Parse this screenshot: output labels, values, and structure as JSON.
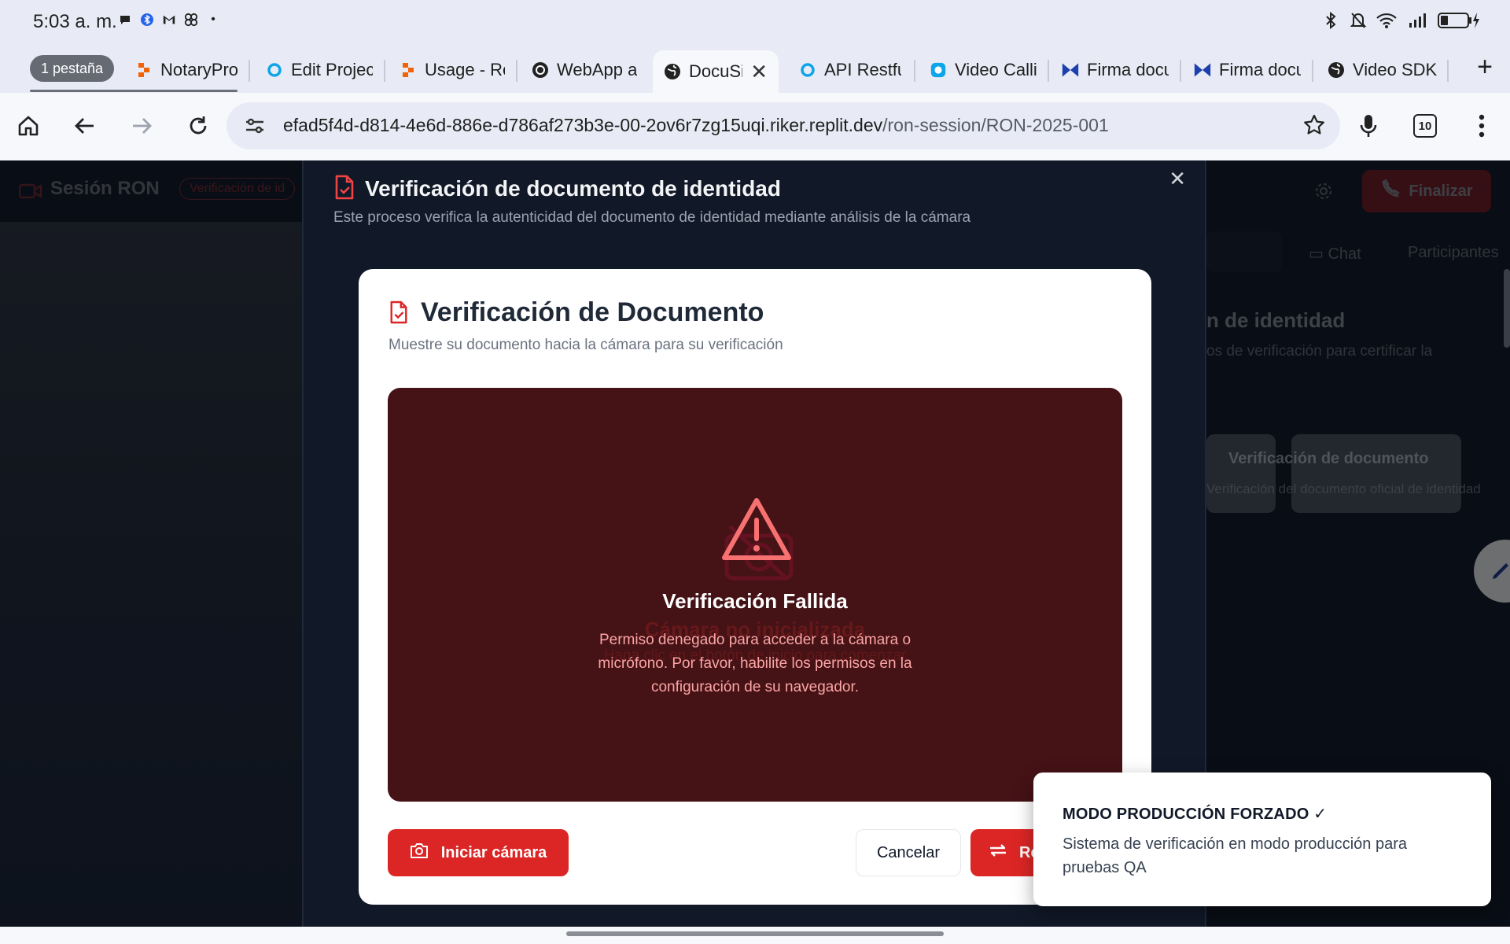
{
  "status_bar": {
    "time": "5:03 a. m.",
    "notification_icons": [
      "chat-bubble-icon",
      "bluetooth-app-icon",
      "gmail-icon",
      "pinwheel-icon",
      "dot-icon"
    ],
    "right_icons": [
      "bluetooth-icon",
      "mute-icon",
      "wifi-icon",
      "4g-signal-icon",
      "battery-charging-icon"
    ]
  },
  "browser": {
    "tab_count_label": "1 pestaña",
    "tabs": [
      {
        "label": "NotaryPro",
        "icon": "replit-icon"
      },
      {
        "label": "Edit Projec",
        "icon": "circle-app-icon"
      },
      {
        "label": "Usage - Re",
        "icon": "replit-icon"
      },
      {
        "label": "WebApp a",
        "icon": "openai-icon"
      },
      {
        "label": "DocuSiç",
        "icon": "globe-icon",
        "active": true
      },
      {
        "label": "API Restful",
        "icon": "circle-app-icon"
      },
      {
        "label": "Video Calli",
        "icon": "circle-app-icon"
      },
      {
        "label": "Firma docu",
        "icon": "bowtie-icon"
      },
      {
        "label": "Firma docu",
        "icon": "bowtie-icon"
      },
      {
        "label": "Video SDK",
        "icon": "globe-icon"
      }
    ],
    "url_host": "efad5f4d-d814-4e6d-886e-d786af273b3e-00-2ov6r7zg15uqi.riker.replit.dev",
    "url_path": "/ron-session/RON-2025-001",
    "tab_switcher_count": "10"
  },
  "page": {
    "header_title": "Sesión RON",
    "header_badge": "Verificación de id",
    "end_button": "Finalizar",
    "right_tabs": [
      "Chat",
      "Participantes"
    ],
    "right_heading": "n de identidad",
    "right_sub": "os de verificación para certificar la",
    "right_card_title": "Verificación de documento",
    "right_card_desc": "Verificación del documento oficial de identidad"
  },
  "outer_dialog": {
    "title": "Verificación de documento de identidad",
    "subtitle": "Este proceso verifica la autenticidad del documento de identidad mediante análisis de la cámara"
  },
  "card": {
    "title": "Verificación de Documento",
    "subtitle": "Muestre su documento hacia la cámara para su verificación",
    "ghost_title": "Cámara no inicializada",
    "ghost_sub": "Haga clic en el botón de inicio para comenzar",
    "error_title": "Verificación Fallida",
    "error_message": "Permiso denegado para acceder a la cámara o micrófono. Por favor, habilite los permisos en la configuración de su navegador.",
    "start_camera_button": "Iniciar cámara",
    "cancel_button": "Cancelar",
    "retry_button": "Reintentar"
  },
  "toast": {
    "title": "MODO PRODUCCIÓN FORZADO ✓",
    "description": "Sistema de verificación en modo producción para pruebas QA"
  },
  "colors": {
    "accent_red": "#dc2626",
    "error_bg": "#451216",
    "dialog_bg": "#111827"
  }
}
